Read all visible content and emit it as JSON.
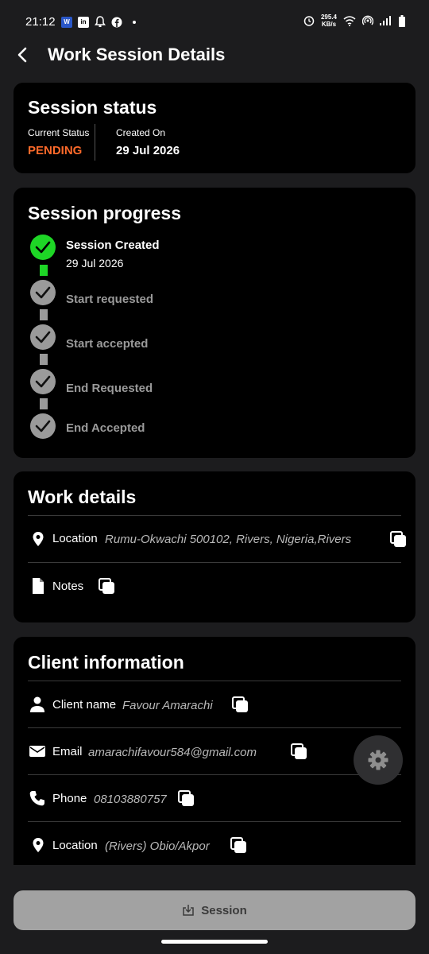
{
  "status_bar": {
    "time": "21:12",
    "net_speed_value": "295.4",
    "net_speed_unit": "KB/s",
    "left_icons": [
      "app-w-icon",
      "linkedin-icon",
      "bell-icon",
      "facebook-icon",
      "dot-icon"
    ],
    "right_icons": [
      "alarm-icon",
      "wifi-icon",
      "hotspot-icon",
      "signal-icon",
      "battery-icon"
    ]
  },
  "header": {
    "title": "Work Session Details"
  },
  "session_status": {
    "title": "Session status",
    "current_status_label": "Current Status",
    "current_status_value": "PENDING",
    "created_on_label": "Created On",
    "created_on_value": "29 Jul 2026",
    "status_color": "#ff6a2a"
  },
  "session_progress": {
    "title": "Session progress",
    "steps": [
      {
        "label": "Session Created",
        "date": "29 Jul 2026",
        "done": true
      },
      {
        "label": "Start requested",
        "done": false
      },
      {
        "label": "Start accepted",
        "done": false
      },
      {
        "label": "End Requested",
        "done": false
      },
      {
        "label": "End Accepted",
        "done": false
      }
    ],
    "done_color": "#1ed626",
    "pending_color": "#9a9a9a"
  },
  "work_details": {
    "title": "Work details",
    "location_label": "Location",
    "location_value": "Rumu-Okwachi 500102, Rivers, Nigeria,Rivers",
    "notes_label": "Notes"
  },
  "client_info": {
    "title": "Client information",
    "name_label": "Client name",
    "name_value": "Favour Amarachi",
    "email_label": "Email",
    "email_value": "amarachifavour584@gmail.com",
    "phone_label": "Phone",
    "phone_value": "08103880757",
    "location_label": "Location",
    "location_value": "(Rivers) Obio/Akpor"
  },
  "bottom_button": {
    "label": "Session"
  }
}
